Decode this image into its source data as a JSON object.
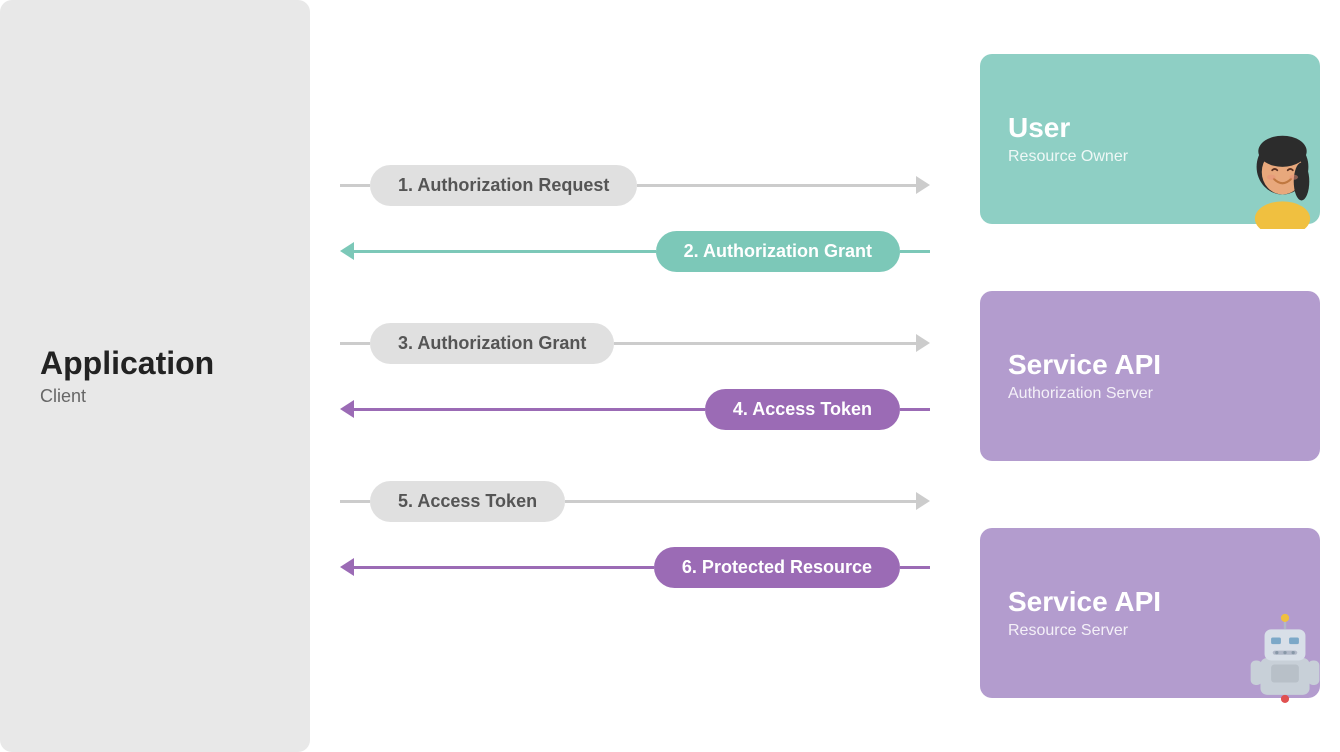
{
  "left": {
    "title": "Application",
    "subtitle": "Client"
  },
  "flows": [
    {
      "id": "flow1",
      "arrows": [
        {
          "id": "arrow1",
          "label": "1. Authorization Request",
          "direction": "right",
          "style": "gray"
        },
        {
          "id": "arrow2",
          "label": "2. Authorization Grant",
          "direction": "left",
          "style": "teal"
        }
      ]
    },
    {
      "id": "flow2",
      "arrows": [
        {
          "id": "arrow3",
          "label": "3. Authorization Grant",
          "direction": "right",
          "style": "gray"
        },
        {
          "id": "arrow4",
          "label": "4. Access Token",
          "direction": "left",
          "style": "purple"
        }
      ]
    },
    {
      "id": "flow3",
      "arrows": [
        {
          "id": "arrow5",
          "label": "5. Access Token",
          "direction": "right",
          "style": "gray"
        },
        {
          "id": "arrow6",
          "label": "6. Protected Resource",
          "direction": "left",
          "style": "purple"
        }
      ]
    }
  ],
  "boxes": [
    {
      "id": "box-user",
      "title": "User",
      "subtitle": "Resource Owner",
      "style": "teal",
      "avatar": "person"
    },
    {
      "id": "box-auth-server",
      "title": "Service API",
      "subtitle": "Authorization Server",
      "style": "purple",
      "avatar": null
    },
    {
      "id": "box-resource-server",
      "title": "Service API",
      "subtitle": "Resource Server",
      "style": "purple",
      "avatar": "robot"
    }
  ]
}
